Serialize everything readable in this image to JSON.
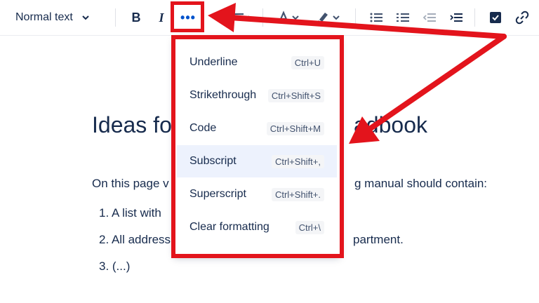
{
  "toolbar": {
    "text_style": "Normal text",
    "bold": "B",
    "italic": "I",
    "more": "•••"
  },
  "menu": {
    "items": [
      {
        "label": "Underline",
        "shortcut": "Ctrl+U"
      },
      {
        "label": "Strikethrough",
        "shortcut": "Ctrl+Shift+S"
      },
      {
        "label": "Code",
        "shortcut": "Ctrl+Shift+M"
      },
      {
        "label": "Subscript",
        "shortcut": "Ctrl+Shift+,"
      },
      {
        "label": "Superscript",
        "shortcut": "Ctrl+Shift+."
      },
      {
        "label": "Clear formatting",
        "shortcut": "Ctrl+\\"
      }
    ],
    "highlighted_index": 3
  },
  "document": {
    "title_start": "Ideas fo",
    "title_end": "adbook",
    "paragraph_start": "On this page v",
    "paragraph_end": "g manual should contain:",
    "list": [
      {
        "start": "1. A list with",
        "end": ""
      },
      {
        "start": "2. All address",
        "end": "partment."
      },
      {
        "start": "3. (...)",
        "end": ""
      }
    ]
  },
  "colors": {
    "annotation": "#e3141c",
    "accent": "#0052cc",
    "text": "#172b4d",
    "highlight_row": "#edf2fd"
  },
  "icons": [
    "chevron-down-icon",
    "text-color-icon",
    "highlight-icon",
    "bullet-list-icon",
    "numbered-list-icon",
    "outdent-icon",
    "indent-icon",
    "task-checkbox-icon",
    "link-icon"
  ]
}
